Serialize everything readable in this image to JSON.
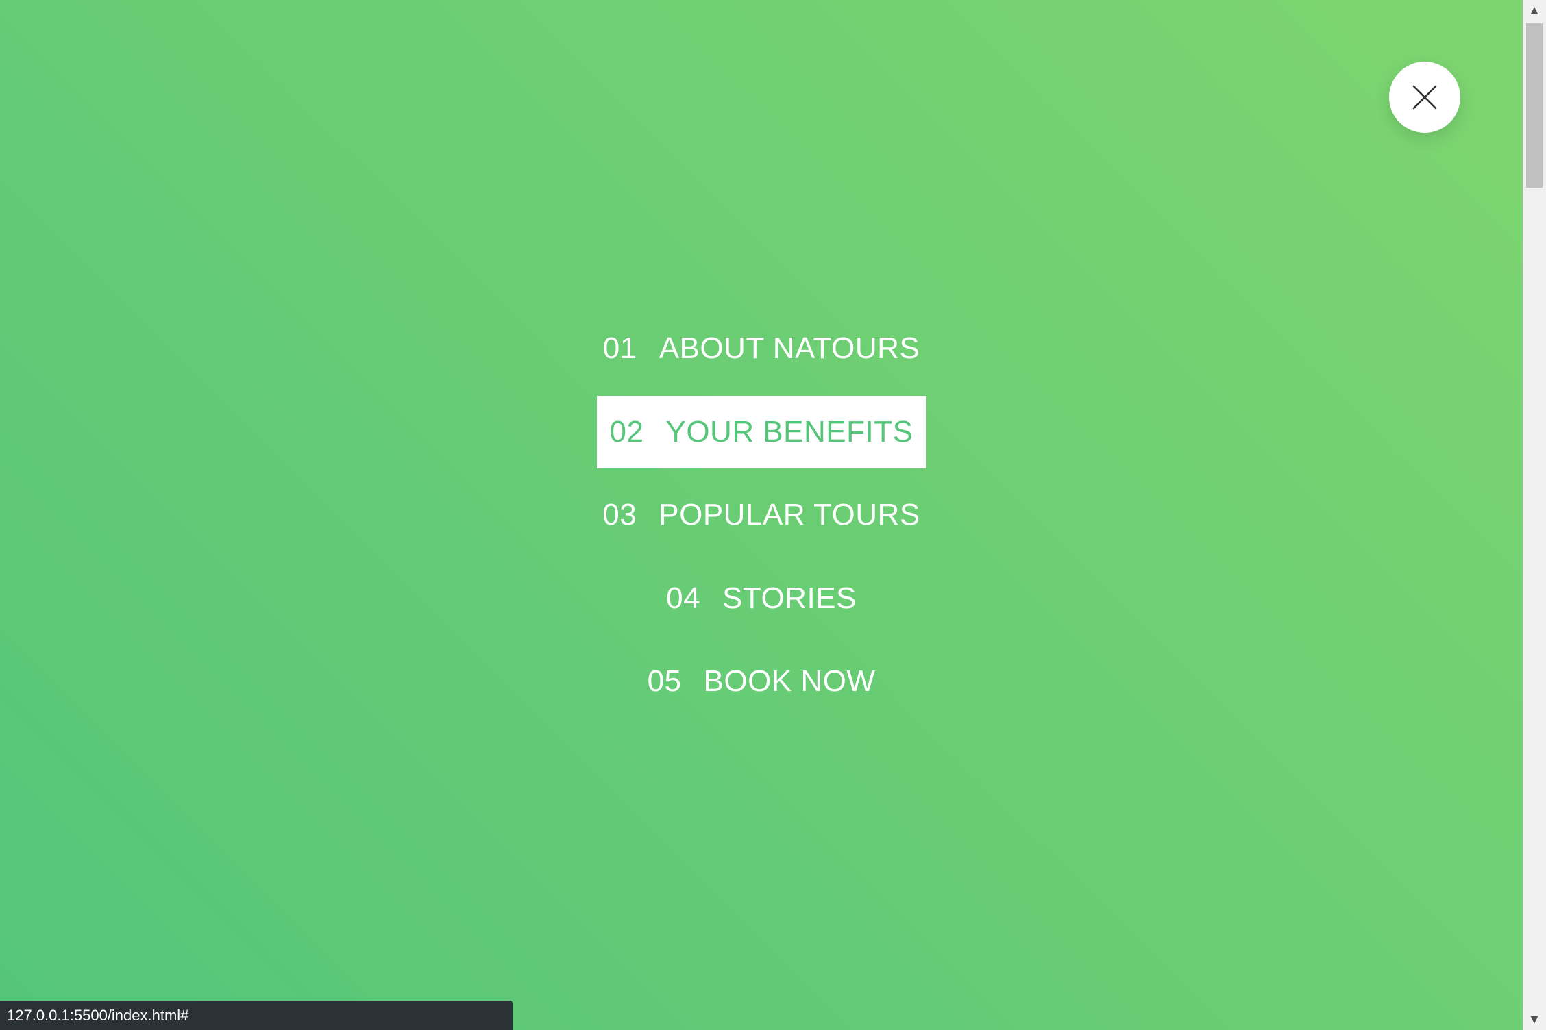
{
  "colors": {
    "gradient_start": "#55c57a",
    "gradient_end": "#7ed56f",
    "active_item_text": "#55c57a",
    "status_bar_bg": "#2b3236"
  },
  "close_button": {
    "icon": "close-icon"
  },
  "navigation": {
    "items": [
      {
        "number": "01",
        "label": "ABOUT NATOURS",
        "active": false
      },
      {
        "number": "02",
        "label": "YOUR BENEFITS",
        "active": true
      },
      {
        "number": "03",
        "label": "POPULAR TOURS",
        "active": false
      },
      {
        "number": "04",
        "label": "STORIES",
        "active": false
      },
      {
        "number": "05",
        "label": "BOOK NOW",
        "active": false
      }
    ]
  },
  "scrollbar": {
    "up_icon": "scroll-up-arrow-icon",
    "down_icon": "scroll-down-arrow-icon"
  },
  "status_bar": {
    "url": "127.0.0.1:5500/index.html#"
  }
}
